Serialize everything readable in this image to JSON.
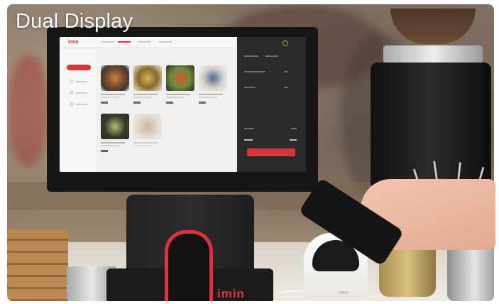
{
  "headline": {
    "text": "Dual Display"
  },
  "device": {
    "brand_logo": "imin",
    "reader_logo": "imin"
  },
  "screen": {
    "logo": "imin",
    "accent_color": "#e0323a"
  },
  "icons": {
    "reader": "nfc-reader-icon",
    "phone": "smartphone-icon"
  }
}
